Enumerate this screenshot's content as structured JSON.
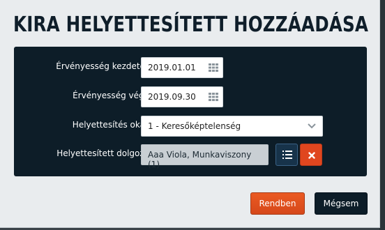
{
  "dialog": {
    "title": "KIRA HELYETTESÍTETT HOZZÁADÁSA"
  },
  "form": {
    "start_date": {
      "label": "Érvényesség kezdete*",
      "value": "2019.01.01",
      "icon": "calendar-icon"
    },
    "end_date": {
      "label": "Érvényesség vége",
      "value": "2019.09.30",
      "icon": "calendar-icon"
    },
    "reason": {
      "label": "Helyettesítés oka*",
      "value": "1 - Keresőképtelenség",
      "icon": "chevron-down-icon"
    },
    "employee": {
      "label": "Helyettesített dolgozó",
      "value": "Aaa Viola, Munkaviszony (1)",
      "list_icon": "list-icon",
      "clear_icon": "close-icon"
    }
  },
  "footer": {
    "ok_label": "Rendben",
    "cancel_label": "Mégsem"
  },
  "colors": {
    "panel": "#0d1d28",
    "primary_button": "#e0461f",
    "secondary_button": "#0d1d28"
  }
}
